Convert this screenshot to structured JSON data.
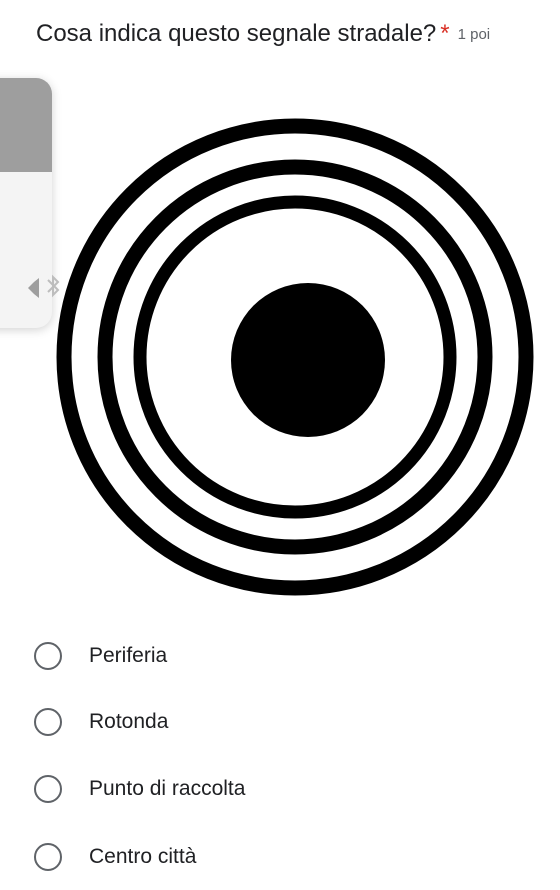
{
  "question": {
    "title": "Cosa indica questo segnale stradale?",
    "required_marker": "*",
    "points_label": "1 poi"
  },
  "overlay": {
    "icons": [
      "volume-icon",
      "bluetooth-icon"
    ]
  },
  "sign_image": {
    "icon": "concentric-circles-sign-icon",
    "colors": {
      "rings": "#000000",
      "background": "#ffffff"
    }
  },
  "options": [
    {
      "label": "Periferia",
      "selected": false
    },
    {
      "label": "Rotonda",
      "selected": false
    },
    {
      "label": "Punto di raccolta",
      "selected": false
    },
    {
      "label": "Centro città",
      "selected": false
    }
  ],
  "colors": {
    "required": "#d93025",
    "text": "#202124",
    "secondary_text": "#5f6368",
    "radio_border": "#5f6368"
  }
}
